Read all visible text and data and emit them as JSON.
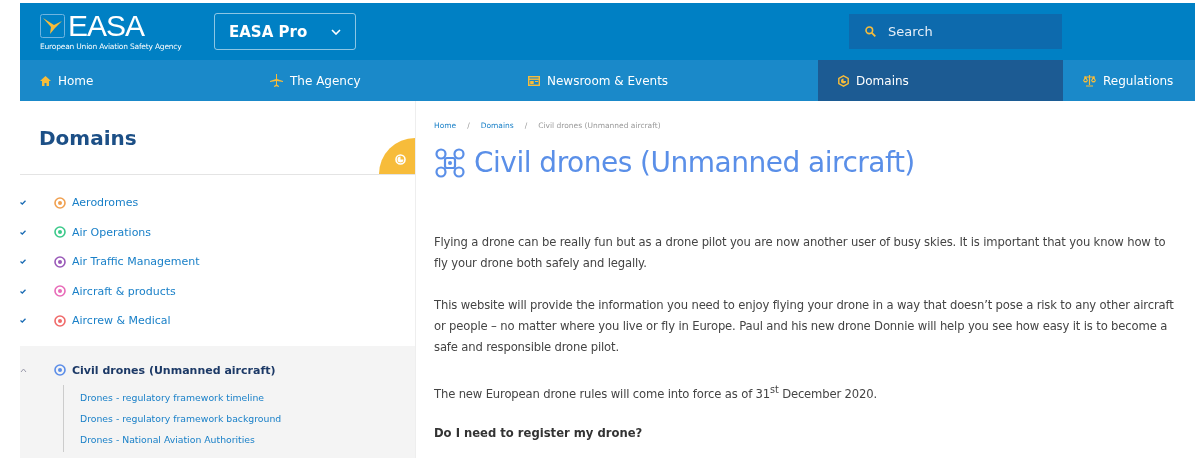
{
  "logo": {
    "wordmark": "EASA",
    "tagline": "European Union Aviation Safety Agency"
  },
  "portal_selector": {
    "label": "EASA Pro"
  },
  "search": {
    "placeholder": "Search"
  },
  "nav": [
    {
      "label": "Home",
      "kind": "home",
      "selected": false
    },
    {
      "label": "The Agency",
      "kind": "plane",
      "selected": false
    },
    {
      "label": "Newsroom & Events",
      "kind": "news",
      "selected": false
    },
    {
      "label": "Domains",
      "kind": "domains",
      "selected": true
    },
    {
      "label": "Regulations",
      "kind": "scales",
      "selected": false
    }
  ],
  "sidebar": {
    "title": "Domains",
    "items": [
      {
        "label": "Aerodromes",
        "color": "#f0a050",
        "selected": false,
        "expanded": false
      },
      {
        "label": "Air Operations",
        "color": "#3cc98a",
        "selected": false,
        "expanded": false
      },
      {
        "label": "Air Traffic Management",
        "color": "#9a5ab8",
        "selected": false,
        "expanded": false
      },
      {
        "label": "Aircraft & products",
        "color": "#e86bb8",
        "selected": false,
        "expanded": false
      },
      {
        "label": "Aircrew & Medical",
        "color": "#f06a6a",
        "selected": false,
        "expanded": false
      },
      {
        "label": "Civil drones (Unmanned aircraft)",
        "color": "#5b8de8",
        "selected": true,
        "expanded": true,
        "children": [
          {
            "label": "Drones - regulatory framework timeline"
          },
          {
            "label": "Drones - regulatory framework background"
          },
          {
            "label": "Drones - National Aviation Authorities"
          }
        ]
      }
    ]
  },
  "breadcrumb": [
    {
      "label": "Home",
      "current": false
    },
    {
      "label": "Domains",
      "current": false
    },
    {
      "label": "Civil drones (Unmanned aircraft)",
      "current": true
    }
  ],
  "breadcrumb_separator": "/",
  "page_title": "Civil drones (Unmanned aircraft)",
  "paragraphs": [
    "Flying a drone can be really fun but as a drone pilot you are now another user of busy skies. It is important that you know how to fly your drone both safely and legally.",
    "This website will provide the information you need to enjoy flying your drone in a way that doesn’t pose a risk to any other aircraft or people – no matter where you live or fly in Europe. Paul and his new drone Donnie will help you see how easy it is to become a safe and responsible drone pilot.",
    "The new European drone rules will come into force as of 31$^{st}$ December 2020."
  ],
  "subheading": "Do I need to register my drone?"
}
